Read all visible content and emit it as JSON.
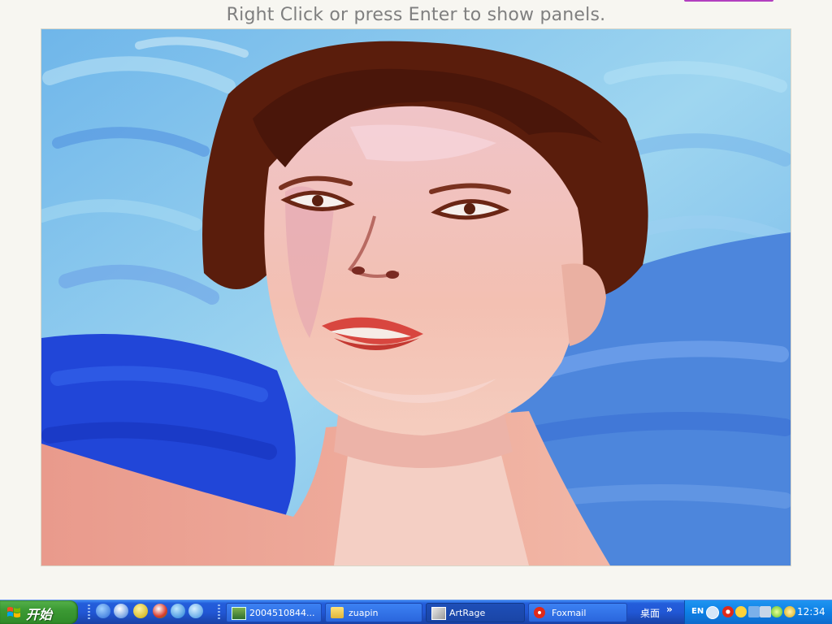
{
  "app": {
    "hint_text": "Right Click or press Enter to show panels.",
    "accent": "#b23fbf"
  },
  "canvas": {
    "content": "oil-painting-portrait",
    "palette": {
      "sky_light": "#8fd0ec",
      "sky_mid": "#5aa7e6",
      "blue_deep": "#1f3fd6",
      "hair": "#5a1d0c",
      "skin": "#f2b9ae",
      "skin_light": "#f6d6cf",
      "lips": "#d8463f"
    }
  },
  "taskbar": {
    "start_label": "开始",
    "quick_launch": [
      "media-icon",
      "info-icon",
      "cd-icon",
      "player-icon",
      "ie-icon",
      "web-icon"
    ],
    "tasks": [
      {
        "label": "2004510844...",
        "icon": "image-icon",
        "active": false
      },
      {
        "label": "zuapin",
        "icon": "folder-icon",
        "active": false
      },
      {
        "label": "ArtRage",
        "icon": "artrage-icon",
        "active": true
      },
      {
        "label": "Foxmail",
        "icon": "foxmail-icon",
        "active": false
      }
    ],
    "desktop_label": "桌面",
    "chevron": "»",
    "tray": {
      "lang": "EN",
      "icons": [
        "back-icon",
        "foxmail-tray-icon",
        "gear-icon",
        "network-icon",
        "speaker-icon",
        "green-k-icon",
        "yellow-icon"
      ],
      "clock": "12:34"
    },
    "colors": {
      "bar": "#245edb",
      "start": "#3c9a34",
      "tray": "#0d80e6"
    }
  }
}
